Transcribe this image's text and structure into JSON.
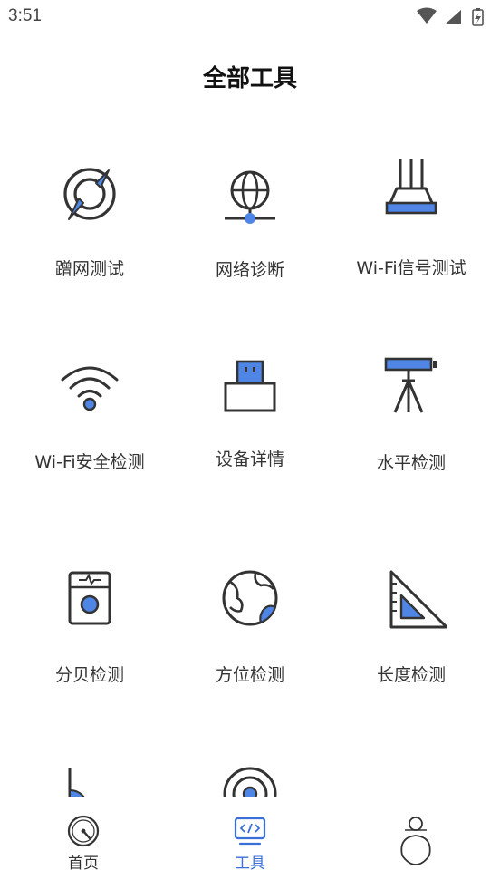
{
  "status": {
    "time": "3:51"
  },
  "header": {
    "title": "全部工具"
  },
  "tools": [
    {
      "label": "蹭网测试",
      "icon": "compass-icon"
    },
    {
      "label": "网络诊断",
      "icon": "globe-network-icon"
    },
    {
      "label": "Wi-Fi信号测试",
      "icon": "router-icon"
    },
    {
      "label": "Wi-Fi安全检测",
      "icon": "wifi-icon"
    },
    {
      "label": "设备详情",
      "icon": "usb-device-icon"
    },
    {
      "label": "水平检测",
      "icon": "level-tripod-icon"
    },
    {
      "label": "分贝检测",
      "icon": "decibel-meter-icon"
    },
    {
      "label": "方位检测",
      "icon": "earth-icon"
    },
    {
      "label": "长度检测",
      "icon": "triangle-ruler-icon"
    },
    {
      "label": "",
      "icon": "angle-icon"
    },
    {
      "label": "",
      "icon": "radar-icon"
    }
  ],
  "nav": {
    "home": "首页",
    "tools": "工具",
    "profile": ""
  },
  "colors": {
    "accent": "#3a6fd8",
    "icon_fill": "#4f86e6",
    "icon_stroke": "#333333"
  }
}
